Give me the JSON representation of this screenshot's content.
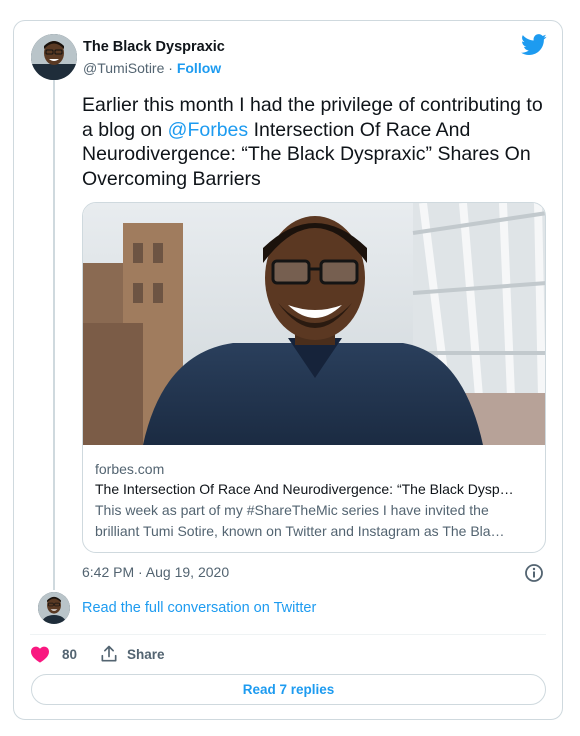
{
  "author": {
    "name": "The Black Dyspraxic",
    "handle": "@TumiSotire",
    "separator": " · ",
    "follow_label": "Follow"
  },
  "tweet": {
    "text_before": "Earlier this month I had the privilege of contributing to a  blog on ",
    "mention": "@Forbes",
    "text_after": " Intersection Of Race And Neurodivergence: “The Black Dyspraxic” Shares On Overcoming Barriers"
  },
  "link_card": {
    "domain": "forbes.com",
    "title": "The Intersection Of Race And Neurodivergence: “The Black Dysp…",
    "description": "This week as part of my #ShareTheMic series I have invited the brilliant Tumi Sotire, known on Twitter and Instagram as The Bla…"
  },
  "meta": {
    "timestamp": "6:42 PM · Aug 19, 2020",
    "read_conversation": "Read the full conversation on Twitter"
  },
  "actions": {
    "like_count": "80",
    "share_label": "Share",
    "read_replies": "Read 7 replies"
  },
  "icons": {
    "twitter": "twitter-bird-icon",
    "info": "info-icon",
    "like": "heart-icon",
    "share": "share-upload-icon"
  },
  "colors": {
    "accent": "#1d9bf0",
    "like": "#f91880",
    "text": "#0f1419",
    "muted": "#536471",
    "border": "#cfd9de"
  }
}
